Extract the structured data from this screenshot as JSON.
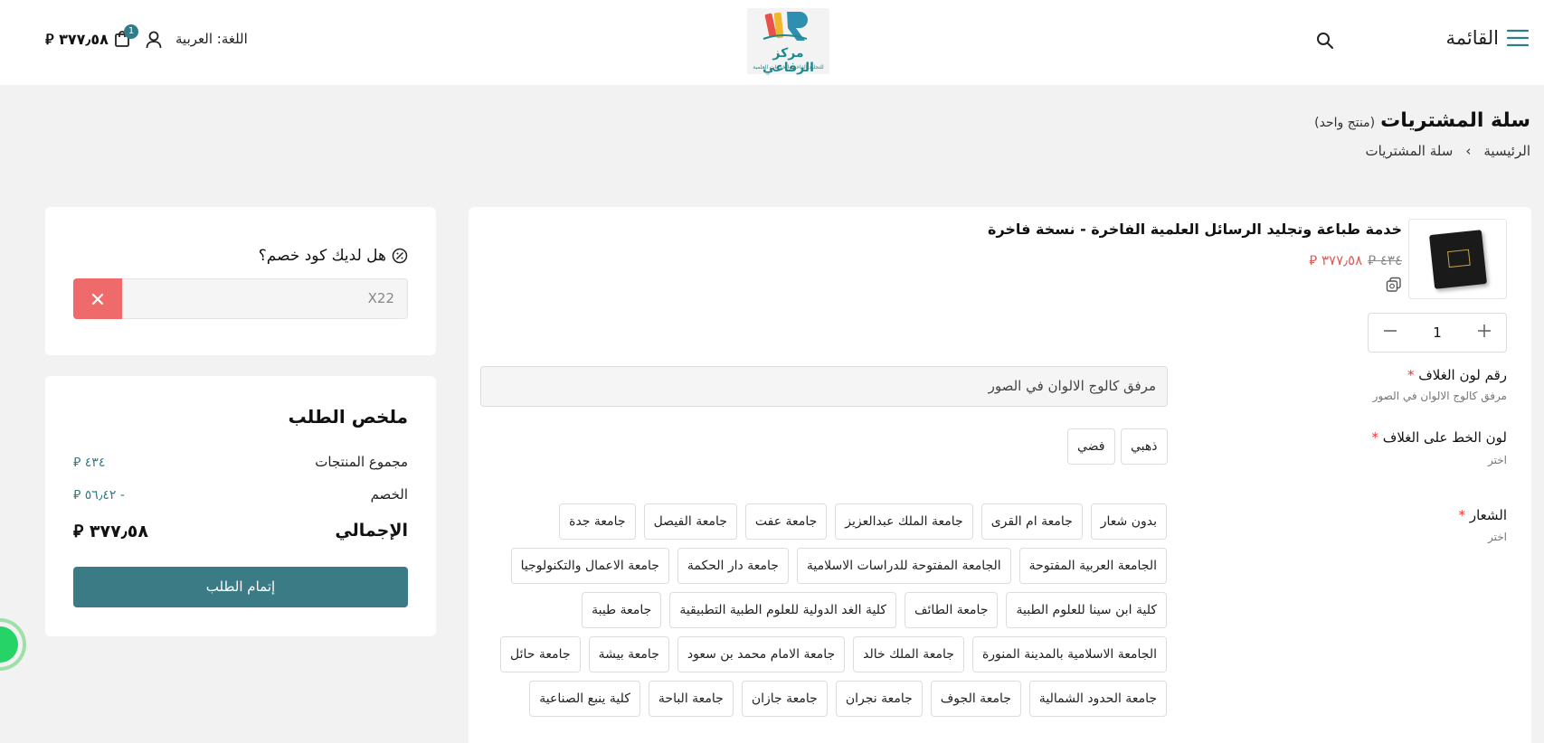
{
  "header": {
    "menu_label": "القائمة",
    "logo_title": "مركز الرفاعي",
    "logo_subtitle": "للتجليد الفاخر والخدمات العلمية",
    "language": "اللغة: العربية",
    "cart_badge": "1",
    "cart_total": "٣٧٧٫٥٨ ⃁"
  },
  "page": {
    "title": "سلة المشتريات",
    "count": "(منتج واحد)",
    "breadcrumb": [
      "الرئيسية",
      "›",
      "سلة المشتريات"
    ]
  },
  "product": {
    "title": "خدمة طباعة وتجليد الرسائل العلمية الفاخرة - نسخة فاخرة",
    "old_price": "٤٣٤ ⃁",
    "new_price": "٣٧٧٫٥٨ ⃁",
    "quantity": "1",
    "fields": {
      "cover_color": {
        "label": "رقم لون الغلاف",
        "required": "*",
        "hint": "مرفق كالوج الالوان في الصور",
        "value": "مرفق كالوج الالوان في الصور"
      },
      "text_color": {
        "label": "لون الخط على الغلاف",
        "required": "*",
        "hint": "اختر",
        "options": [
          "ذهبي",
          "فضي"
        ]
      },
      "logo": {
        "label": "الشعار",
        "required": "*",
        "hint": "اختر"
      }
    },
    "logo_options": [
      "بدون شعار",
      "جامعة ام القرى",
      "جامعة الملك عبدالعزيز",
      "جامعة عفت",
      "جامعة الفيصل",
      "جامعة جدة",
      "الجامعة العربية المفتوحة",
      "الجامعة المفتوحة للدراسات الاسلامية",
      "جامعة دار الحكمة",
      "جامعة الاعمال والتكنولوجيا",
      "كلية ابن سينا للعلوم الطبية",
      "جامعة الطائف",
      "كلية الغد الدولية للعلوم الطبية التطبيقية",
      "جامعة طيبة",
      "الجامعة الاسلامية بالمدينة المنورة",
      "جامعة الملك خالد",
      "جامعة الامام محمد بن سعود",
      "جامعة بيشة",
      "جامعة حائل",
      "جامعة الحدود الشمالية",
      "جامعة الجوف",
      "جامعة نجران",
      "جامعة جازان",
      "جامعة الباحة",
      "كلية ينبع الصناعية"
    ]
  },
  "discount": {
    "question": "هل لديك كود خصم؟",
    "code": "X22"
  },
  "summary": {
    "title": "ملخص الطلب",
    "subtotal_label": "مجموع المنتجات",
    "subtotal_value": "٤٣٤ ⃁",
    "discount_label": "الخصم",
    "discount_value": "- ٥٦٫٤٢ ⃁",
    "total_label": "الإجمالي",
    "total_value": "٣٧٧٫٥٨ ⃁",
    "checkout_label": "إتمام الطلب"
  },
  "colors": {
    "accent": "#3b7b86",
    "sale": "#e05a5a",
    "remove": "#ef6b6b"
  }
}
